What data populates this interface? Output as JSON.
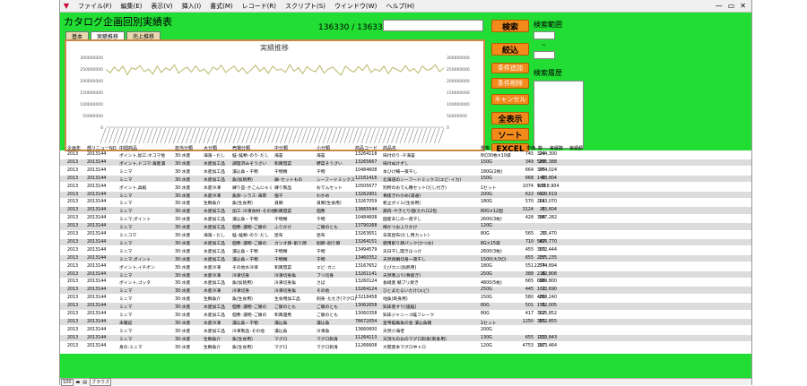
{
  "menu": {
    "items": [
      "ファイル(F)",
      "編集(E)",
      "表示(V)",
      "挿入(I)",
      "書式(M)",
      "レコード(R)",
      "スクリプト(S)",
      "ウインドウ(W)",
      "ヘルプ(H)"
    ],
    "controls": [
      "—",
      "▭",
      "✕"
    ]
  },
  "header": {
    "title": "カタログ企画回別実績表",
    "record_count": "136330 / 136330 件",
    "tabs": [
      "基本",
      "実績推移",
      "売上推移"
    ],
    "active_tab": 1
  },
  "buttons": {
    "search": "検索",
    "narrow": "絞込",
    "add_condition": "条件追加",
    "remove_condition": "条件削除",
    "cancel": "キャンセル",
    "show_all": "全表示",
    "sort": "ソート",
    "excel": "EXCEL"
  },
  "side": {
    "search_range_label": "検索範囲",
    "range_sep": "~",
    "search_history_label": "検索履歴"
  },
  "chart_data": {
    "type": "line",
    "title": "実績推移",
    "ylim": [
      0,
      300000000
    ],
    "yticks": [
      "300000000",
      "250000000",
      "200000000",
      "150000000",
      "100000000",
      "50000000",
      "0"
    ],
    "series": [
      {
        "color": "#b9b86a",
        "values": [
          248,
          233,
          258,
          240,
          262,
          225,
          255,
          248,
          265,
          238,
          250,
          228,
          262,
          235,
          255,
          244,
          268,
          232,
          248,
          258,
          236,
          263,
          240,
          250,
          228,
          258,
          246,
          266,
          235,
          250,
          262,
          238,
          255,
          230,
          248,
          266,
          240,
          256,
          232,
          262,
          245,
          250,
          235,
          268,
          240,
          256,
          230,
          260,
          245,
          238,
          265,
          232,
          250,
          258,
          240,
          224,
          262,
          246,
          236,
          260,
          244,
          268,
          235,
          250,
          240,
          262,
          230,
          256,
          248,
          238,
          265,
          240,
          252,
          232,
          262,
          245,
          250,
          268,
          238,
          255
        ]
      }
    ],
    "grid": false,
    "x_tick_count": 80
  },
  "columns": [
    "企画年",
    "部リニューNO",
    "中間商品",
    "担当分類",
    "大分類",
    "売場分類",
    "中分類",
    "小分類",
    "商品コード",
    "商品名",
    "規格",
    "単価",
    "数",
    "実績数",
    "実績額"
  ],
  "rows": [
    [
      "2013",
      "2013144",
      "ポイント,加工:ネコマ他",
      "30:水産",
      "海藻・だし",
      "鮭･鮭類･のり･だし",
      "海苔",
      "海苔",
      "13264118",
      "味付のり･チ海苔",
      "8切30枚×10袋",
      "745",
      "320",
      "244,300"
    ],
    [
      "2013",
      "2013144",
      "ポイント,ドコマ:海産漬",
      "30:水産",
      "水産加工品",
      "調理済みそうざい",
      "和風惣菜",
      "野菜そうざい",
      "13265667",
      "味付ぬけずし",
      "150G",
      "349",
      "589",
      "205,388"
    ],
    [
      "2013",
      "2013144",
      "ミニマ",
      "30:水産",
      "水産加工品",
      "漬込魚・干物",
      "干物類",
      "干物",
      "10484608",
      "本ひけ鯖一夜干し",
      "180G(2枚)",
      "664",
      "396",
      "274,024"
    ],
    [
      "2013",
      "2013144",
      "ミニマ",
      "30:水産",
      "水産加工品",
      "魚(加熱用)",
      "鍋･セットもの",
      "シーフードミックス",
      "12161416",
      "北海道のシーフードミックス(エビ･イカ)",
      "150G",
      "668",
      "140",
      "83,804"
    ],
    [
      "2013",
      "2013144",
      "ポイント,具紙",
      "30:水産",
      "水産冷凍",
      "練り品･かこんにゃく",
      "練り製品",
      "おでんセット",
      "10505677",
      "別所のおでん種セット(だし付き)",
      "1セット",
      "1074",
      "988",
      "1,058,904"
    ],
    [
      "2013",
      "2013144",
      "ミニマ",
      "30:水産",
      "水産冷凍",
      "魚卵･シラス･海草",
      "塩干",
      "わかめ",
      "13262901",
      "骨抜きわかめ(湯通)",
      "200G",
      "622",
      "610",
      "410,619"
    ],
    [
      "2013",
      "2013144",
      "ミニマ",
      "30:水産",
      "生鮮魚介",
      "魚(生食用)",
      "貝類",
      "貝類(生食用)",
      "13267059",
      "帆立ボイル(生食用)",
      "180G",
      "570",
      "261",
      "143,070"
    ],
    [
      "2013",
      "2013144",
      "ミニマ",
      "30:水産",
      "水産加工品",
      "加工･冷凍食材･その他",
      "和風惣菜",
      "佃煮",
      "13665544",
      "鶏肉･やきとり佃(たれ)12包",
      "80G×12個",
      "3124",
      "21",
      "65,604"
    ],
    [
      "2013",
      "2013144",
      "ミニマ,ポイント",
      "30:水産",
      "水産加工品",
      "漬込魚・干物",
      "干物類",
      "干物",
      "10484608",
      "国産あじの一夜干し",
      "2600(3枚)",
      "428",
      "384",
      "167,282"
    ],
    [
      "2013",
      "2013144",
      "ミニマ",
      "30:水産",
      "水産加工品",
      "佃煮･漬物･ご飯の",
      "ふりかけ",
      "ご飯のとも",
      "13790268",
      "梅かつおふりかけ",
      "120G",
      "",
      "",
      ""
    ],
    [
      "2013",
      "2013144",
      "ミニコマ",
      "30:水産",
      "海藻・だし",
      "鮭･鮭類･のり･だし",
      "昆布",
      "昆布",
      "13263651",
      "日高昆布(だし用カット)",
      "80G",
      "565",
      "26",
      "15,470"
    ],
    [
      "2013",
      "2013144",
      "ミニマ",
      "30:水産",
      "水産加工品",
      "佃煮･漬物･ご飯の",
      "カツオ節･削り節",
      "削節･削り節",
      "13264151",
      "使用削り節パック(かつお)",
      "8G×15袋",
      "710",
      "587",
      "416,770"
    ],
    [
      "2013",
      "2013144",
      "ミニマ",
      "30:水産",
      "水産加工品",
      "漬込魚・干物",
      "干物類",
      "干物",
      "13494579",
      "天日干し開きほっけ",
      "2600(3枚)",
      "455",
      "380",
      "172,444"
    ],
    [
      "2013",
      "2013144",
      "ミニマ,ポイント",
      "30:水産",
      "水産加工品",
      "漬込魚・干物",
      "干物類",
      "干物",
      "13460352",
      "天然真鯛切身一夜干し",
      "1500(大3切)",
      "655",
      "237",
      "155,235"
    ],
    [
      "2013",
      "2013144",
      "ポイント,イチボン",
      "30:水産",
      "水産冷凍",
      "その他水冷凍",
      "和風惣菜",
      "エビ･カニ",
      "13167652",
      "えびカニ(加熱用)",
      "180G",
      "551",
      "2274",
      "574,894"
    ],
    [
      "2013",
      "2013144",
      "ミニマ",
      "30:水産",
      "水産冷凍",
      "冷凍切身",
      "冷凍切身魚",
      "ブリ切身",
      "13261141",
      "天然寒ぶり(骨抜き)",
      "250G",
      "388",
      "218",
      "82,808"
    ],
    [
      "2013",
      "2013144",
      "ポイント,ゴッタ",
      "30:水産",
      "水産加工品",
      "魚(加熱用)",
      "冷凍切身魚",
      "さば",
      "13260124",
      "長崎産 鯖ブリ焼き",
      "4800(5枚)",
      "665",
      "600",
      "389,800"
    ],
    [
      "2013",
      "2013144",
      "ミニマ",
      "30:水産",
      "水産冷凍",
      "冷凍切身",
      "冷凍切身魚",
      "その他",
      "13264124",
      "ひとまたるいたけ(エビ)",
      "250G",
      "445",
      "162",
      "72,690"
    ],
    [
      "2013",
      "2013144",
      "ミニマ",
      "30:水産",
      "生鮮魚介",
      "魚(生食用)",
      "生食用加工品",
      "刺身･たたき(マグロ)",
      "13218458",
      "地魚(刺身用)",
      "150G",
      "580",
      "486",
      "258,240"
    ],
    [
      "2013",
      "2013144",
      "ミニマ",
      "30:水産",
      "水産加工品",
      "佃煮･漬物･ご飯の",
      "ご飯のとも",
      "ご飯のとも",
      "13062658",
      "知床産すり(塩鮭)",
      "80G",
      "501",
      "155",
      "82,005"
    ],
    [
      "2013",
      "2013144",
      "ミニマ",
      "30:水産",
      "水産加工品",
      "佃煮･漬物･ご飯の",
      "和風佃煮",
      "ご飯のとも",
      "13060358",
      "知床ジャニーゴ鮭フレーク",
      "80G",
      "417",
      "382",
      "125,852"
    ],
    [
      "2013",
      "2013144",
      "未確認",
      "30:水産",
      "水産冷凍",
      "漬込魚・干物",
      "漬込魚",
      "漬込魚",
      "78672054",
      "皇帝鮭角魚の金 漬込魚箱",
      "1セット",
      "1250",
      "365",
      "372,855"
    ],
    [
      "2013",
      "2013144",
      "ミニマ",
      "30:水産",
      "水産加工品",
      "冷凍製品･その他",
      "漬込魚",
      "冷凍魚",
      "13660600",
      "天然小海老",
      "200G",
      "",
      "",
      ""
    ],
    [
      "2013",
      "2013144",
      "ミニマ",
      "30:水産",
      "生鮮魚介",
      "魚(生食用)",
      "マグロ",
      "マグロ刺身",
      "11264113",
      "天頂ちのおのマグロ刺身(刺身用)",
      "130G",
      "655",
      "133",
      "113,843"
    ],
    [
      "2013",
      "2013144",
      "身の:ミニマ",
      "30:水産",
      "生鮮魚介",
      "魚(生食用)",
      "マグロ",
      "マグロ刺身",
      "11266608",
      "大間産本マグロ中トロ",
      "120G",
      "4753",
      "107",
      "503,464"
    ]
  ],
  "status": {
    "zoom": "100",
    "mode": "ブラウズ"
  }
}
